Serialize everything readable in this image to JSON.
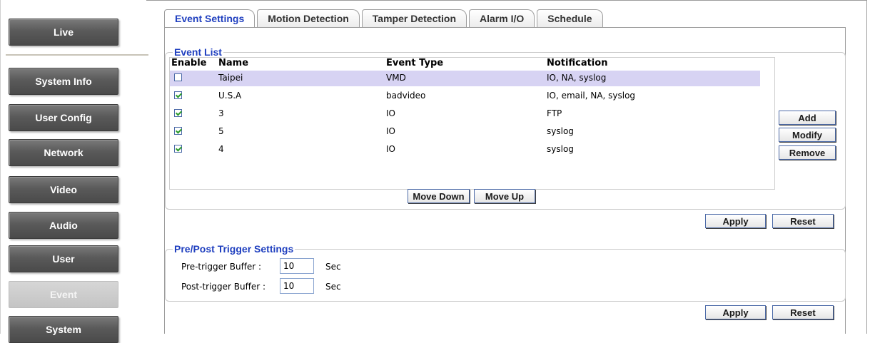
{
  "nav": {
    "items": [
      {
        "label": "Live"
      },
      {
        "label": "System Info"
      },
      {
        "label": "User Config"
      },
      {
        "label": "Network"
      },
      {
        "label": "Video"
      },
      {
        "label": "Audio"
      },
      {
        "label": "User"
      },
      {
        "label": "Event"
      },
      {
        "label": "System"
      }
    ],
    "active": "Event"
  },
  "tabs": [
    {
      "label": "Event Settings"
    },
    {
      "label": "Motion Detection"
    },
    {
      "label": "Tamper Detection"
    },
    {
      "label": "Alarm I/O"
    },
    {
      "label": "Schedule"
    }
  ],
  "active_tab": "Event Settings",
  "event_list": {
    "legend": "Event List",
    "columns": {
      "enable": "Enable",
      "name": "Name",
      "type": "Event Type",
      "notification": "Notification"
    },
    "rows": [
      {
        "enabled": false,
        "name": "Taipei",
        "type": "VMD",
        "notification": "IO, NA, syslog",
        "selected": true
      },
      {
        "enabled": true,
        "name": "U.S.A",
        "type": "badvideo",
        "notification": "IO, email, NA, syslog",
        "selected": false
      },
      {
        "enabled": true,
        "name": "3",
        "type": "IO",
        "notification": "FTP",
        "selected": false
      },
      {
        "enabled": true,
        "name": "5",
        "type": "IO",
        "notification": "syslog",
        "selected": false
      },
      {
        "enabled": true,
        "name": "4",
        "type": "IO",
        "notification": "syslog",
        "selected": false
      }
    ],
    "buttons": {
      "add": "Add",
      "modify": "Modify",
      "remove": "Remove",
      "move_down": "Move Down",
      "move_up": "Move Up"
    }
  },
  "apply_label": "Apply",
  "reset_label": "Reset",
  "trigger": {
    "legend": "Pre/Post Trigger Settings",
    "pre_label": "Pre-trigger Buffer :",
    "pre_value": "10",
    "post_label": "Post-trigger Buffer :",
    "post_value": "10",
    "unit": "Sec"
  }
}
